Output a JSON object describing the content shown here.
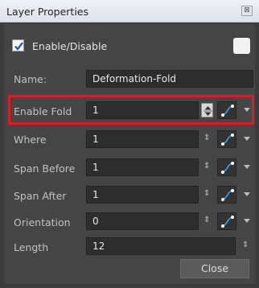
{
  "window": {
    "title": "Layer Properties",
    "close_glyph": "⊠"
  },
  "enable": {
    "label": "Enable/Disable",
    "checked": true,
    "swatch_color": "#f2f2f2"
  },
  "fields": {
    "name": {
      "label": "Name:",
      "value": "Deformation-Fold"
    },
    "enable_fold": {
      "label": "Enable Fold",
      "value": "1"
    },
    "where": {
      "label": "Where",
      "value": "1"
    },
    "span_before": {
      "label": "Span Before",
      "value": "1"
    },
    "span_after": {
      "label": "Span After",
      "value": "1"
    },
    "orientation": {
      "label": "Orientation",
      "value": "0"
    },
    "length": {
      "label": "Length",
      "value": "12"
    }
  },
  "icons": {
    "spin": "spin-arrows-icon",
    "function": "function-curve-icon",
    "dropdown": "chevron-down-icon"
  },
  "buttons": {
    "close": "Close"
  },
  "colors": {
    "highlight": "#d91e1e",
    "panel_bg": "#454545",
    "field_bg": "#2d2d2d",
    "function_icon_blue": "#3aa0e8"
  }
}
